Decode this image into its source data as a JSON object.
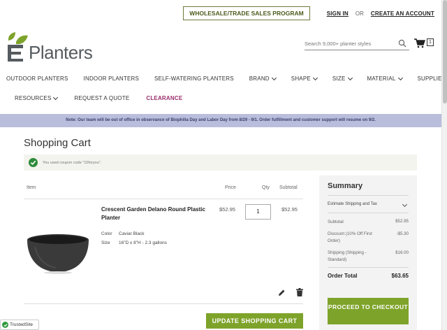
{
  "header": {
    "wholesale_label": "WHOLESALE/TRADE SALES PROGRAM",
    "sign_in": "SIGN IN",
    "or": "OR",
    "create_account": "CREATE AN ACCOUNT",
    "logo_text": "Planters",
    "search_placeholder": "Search 9,000+ planter styles",
    "cart_count": "1"
  },
  "nav": {
    "row1": [
      {
        "label": "OUTDOOR PLANTERS",
        "dropdown": false
      },
      {
        "label": "INDOOR PLANTERS",
        "dropdown": false
      },
      {
        "label": "SELF-WATERING PLANTERS",
        "dropdown": false
      },
      {
        "label": "BRAND",
        "dropdown": true
      },
      {
        "label": "SHAPE",
        "dropdown": true
      },
      {
        "label": "SIZE",
        "dropdown": true
      },
      {
        "label": "MATERIAL",
        "dropdown": true
      },
      {
        "label": "SUPPLIES",
        "dropdown": false
      }
    ],
    "row2": [
      {
        "label": "RESOURCES",
        "dropdown": true
      },
      {
        "label": "REQUEST A QUOTE",
        "dropdown": false
      },
      {
        "label": "CLEARANCE",
        "dropdown": false
      }
    ]
  },
  "notice": "Note: Our team will be out of office in observance of Biophilia Day and Labor Day from 8/29 - 9/1. Order fulfillment and customer support will resume on 9/2.",
  "page": {
    "title": "Shopping Cart",
    "coupon_message": "You used coupon code \"10foryou\"."
  },
  "cart": {
    "headers": {
      "item": "Item",
      "price": "Price",
      "qty": "Qty",
      "subtotal": "Subtotal"
    },
    "item": {
      "name": "Crescent Garden Delano Round Plastic Planter",
      "color_label": "Color",
      "color_value": "Caviar Black",
      "size_label": "Size",
      "size_value": "16\"D x 8\"H - 2.3 gallons",
      "price": "$52.95",
      "qty": "1",
      "subtotal": "$52.95"
    },
    "update_label": "UPDATE SHOPPING CART"
  },
  "summary": {
    "title": "Summary",
    "estimate_label": "Estimate Shipping and Tax",
    "subtotal_label": "Subtotal",
    "subtotal_value": "$52.95",
    "discount_label": "Discount (10% Off First Order)",
    "discount_value": "-$5.30",
    "shipping_label": "Shipping (Shipping - Standard)",
    "shipping_value": "$16.00",
    "total_label": "Order Total",
    "total_value": "$63.65",
    "checkout_label": "PROCEED TO CHECKOUT"
  },
  "badge": {
    "label": "TrustedSite"
  },
  "colors": {
    "brand_green": "#7ea32a",
    "clearance": "#9b2d6b",
    "notice_bg": "#b9bedd"
  }
}
